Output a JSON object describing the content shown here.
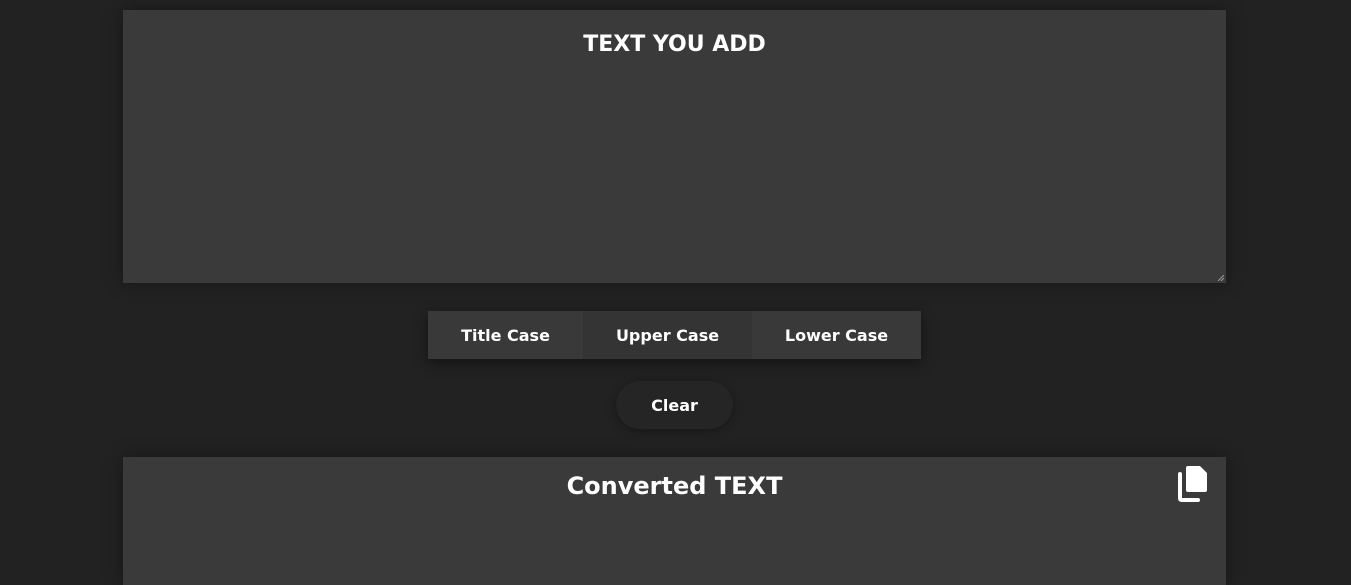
{
  "input": {
    "placeholder": "TEXT YOU ADD",
    "value": ""
  },
  "buttons": {
    "title_case": "Title Case",
    "upper_case": "Upper Case",
    "lower_case": "Lower Case",
    "clear": "Clear"
  },
  "output": {
    "title": "Converted TEXT",
    "copy_icon": "copy-icon"
  },
  "colors": {
    "background": "#222222",
    "panel": "#3a3a3a",
    "button": "#373737",
    "clear_button": "#252525",
    "text": "#ffffff"
  }
}
